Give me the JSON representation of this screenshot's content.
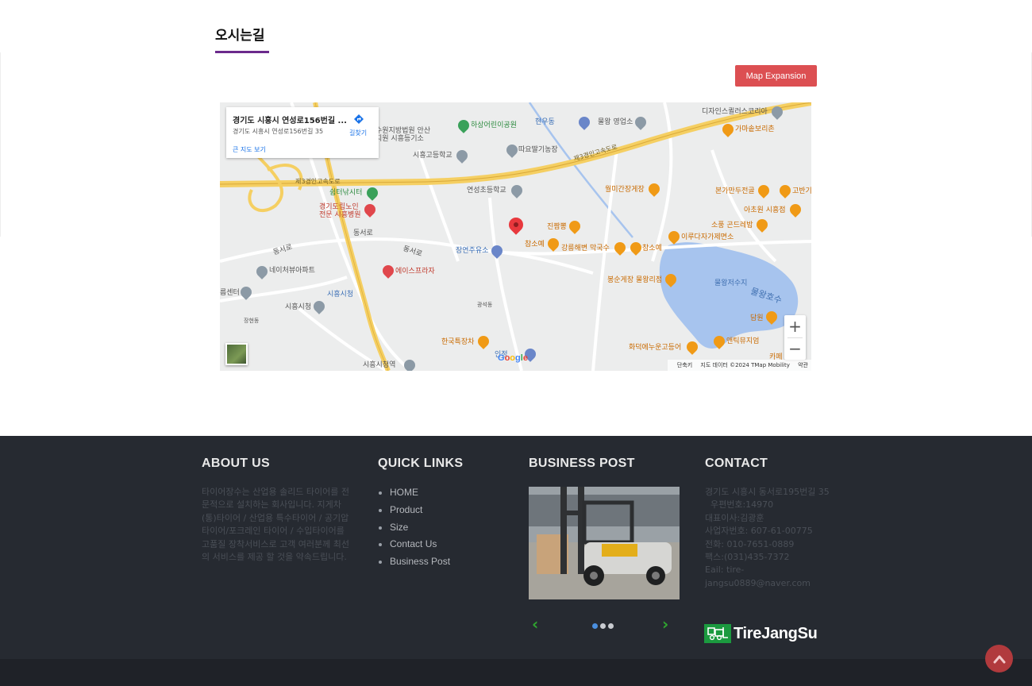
{
  "section": {
    "title": "오시는길"
  },
  "map_button": {
    "label": "Map Expansion"
  },
  "map": {
    "infobox": {
      "title": "경기도 시흥시 연성로156번길 ...",
      "address": "경기도 시흥시 연성로156번길 35",
      "route_label": "길찾기",
      "view_larger": "큰 지도 보기"
    },
    "labels": {
      "design_korea": "디자인스퀼러스코리아",
      "hyeonu": "현우동",
      "water_office": "물왕 영업소",
      "gamasot": "가마솥보리촌",
      "court": "수원지방법원 안산",
      "court2": "지원 시흥등기소",
      "haksang": "하상어린이공원",
      "siheung_high": "시흥고등학교",
      "ttaljip": "따요딸기농장",
      "highway3": "제3경인고속도로",
      "highway3b": "제3경인고속도로",
      "rest": "쉼터낚시터",
      "yeonseong_elem": "연성초등학교",
      "wolmi": "월미간장게장",
      "bonga": "본가만두전골",
      "gobangi": "고반기",
      "achowon": "아초원 시흥점",
      "hospital": "경기도립노인",
      "hospital2": "전문 시흥병원",
      "sobong": "소풍 곤드레밥",
      "jinjjam": "진짬뽕",
      "ilu": "이루다자가제면소",
      "dongseoro": "동서로",
      "dongseoro2": "동서로",
      "dongseoro3": "동서로",
      "chamsoye": "참소예",
      "gangneung": "강릉해변 막국수",
      "chamsoye2": "참소예",
      "jangyeon": "장연주유소",
      "neighbor": "네이처뷰아파트",
      "ace": "에이스프라자",
      "bongsun": "봉순게장 물왕리점",
      "reservoir": "물왕저수지",
      "lake": "물왕호수",
      "siheung_station_m": "시흥시청",
      "center": "름센터",
      "cityhall": "시흥시청",
      "korea_tteok": "한국특장차",
      "hwadeok": "화덕에누운고등어",
      "antique": "앤틱뮤지엄",
      "damwon": "담원",
      "cafe": "카페",
      "station": "시흥시청역",
      "injeong": "인정",
      "gwangseok": "광석동",
      "jangan": "장현동"
    },
    "google": [
      "G",
      "o",
      "o",
      "g",
      "l",
      "e"
    ],
    "footer": {
      "shortcuts": "단축키",
      "mapdata": "지도 데이터 ©2024 TMap Mobility",
      "terms": "약관"
    },
    "zoom_in": "+",
    "zoom_out": "−"
  },
  "footer": {
    "about": {
      "heading": "ABOUT US",
      "text": "타이어장수는 산업용 솔리드 타이어를 전문적으로 설치하는 회사입니다. 지게차(통)타이어 / 산업용 특수타이어 / 공기압 타이어/포크레인 타이어 / 수입타이어를 고품질 장착서비스로 고객 여러분께 최선의 서비스를 제공 할 것을 약속드립니다."
    },
    "quick_links": {
      "heading": "QUICK LINKS",
      "items": [
        "HOME",
        "Product",
        "Size",
        "Contact Us",
        "Business Post"
      ]
    },
    "business_post": {
      "heading": "BUSINESS POST",
      "prev": "‹",
      "next": "›",
      "slide_count": 3,
      "active_slide": 1
    },
    "contact": {
      "heading": "CONTACT",
      "lines": [
        "경기도 시흥시 동서로195번길 35",
        "  우편번호:14970",
        "대표이사:김광훈",
        "사업자번호: 607-61-00775",
        "전화: 010-7651-0889",
        "팩스:(031)435-7372",
        "Eail: tire-",
        "jangsu0889@naver.com"
      ]
    },
    "logo_text": "TireJangSu"
  },
  "colors": {
    "accent_purple": "#6b2a8c",
    "button_red": "#dc4f52",
    "footer_bg": "#262a31",
    "logo_green": "#1b9a3f",
    "to_top": "#b13a3d"
  }
}
